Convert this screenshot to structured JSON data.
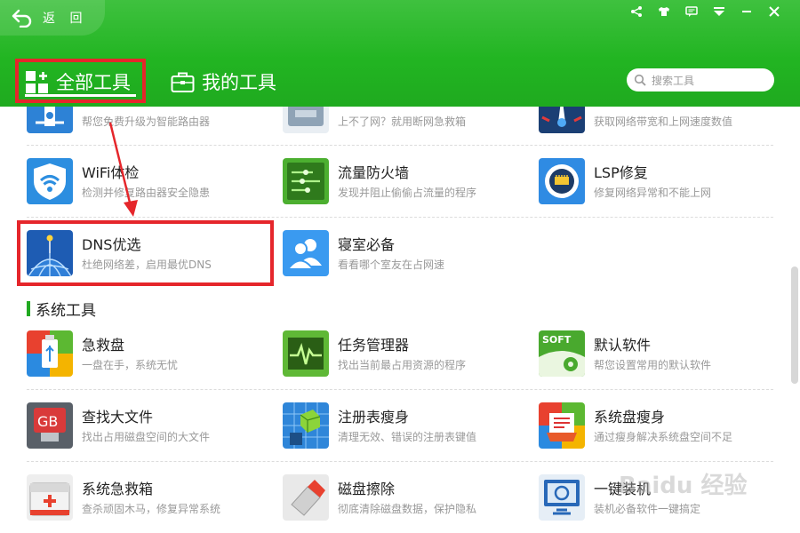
{
  "header": {
    "back_label": "返 回",
    "tabs": [
      {
        "label": "全部工具",
        "icon": "grid-plus-icon"
      },
      {
        "label": "我的工具",
        "icon": "toolbox-icon"
      }
    ],
    "search": {
      "placeholder": "搜索工具"
    },
    "window_controls": [
      "share-icon",
      "skin-icon",
      "message-icon",
      "menu-icon",
      "minimize-icon",
      "close-icon"
    ],
    "colors": {
      "brand_green": "#22b522",
      "highlight_red": "#e5262b"
    }
  },
  "network_tools": {
    "partial_row": [
      {
        "title": "",
        "desc": "帮您免费升级为智能路由器",
        "icon": "router-icon"
      },
      {
        "title": "",
        "desc": "上不了网？就用断网急救箱",
        "icon": "first-aid-box-icon"
      },
      {
        "title": "",
        "desc": "获取网络带宽和上网速度数值",
        "icon": "speedometer-icon"
      }
    ],
    "rows": [
      [
        {
          "title": "WiFi体检",
          "desc": "检测并修复路由器安全隐患",
          "icon": "wifi-shield-icon"
        },
        {
          "title": "流量防火墙",
          "desc": "发现并阻止偷偷占流量的程序",
          "icon": "traffic-firewall-icon"
        },
        {
          "title": "LSP修复",
          "desc": "修复网络异常和不能上网",
          "icon": "lsp-repair-icon"
        }
      ],
      [
        {
          "title": "DNS优选",
          "desc": "杜绝网络差，启用最优DNS",
          "icon": "dns-globe-icon"
        },
        {
          "title": "寝室必备",
          "desc": "看看哪个室友在占网速",
          "icon": "roommates-icon"
        }
      ]
    ]
  },
  "system_tools": {
    "section_title": "系统工具",
    "rows": [
      [
        {
          "title": "急救盘",
          "desc": "一盘在手，系统无忧",
          "icon": "usb-rescue-icon"
        },
        {
          "title": "任务管理器",
          "desc": "找出当前最占用资源的程序",
          "icon": "task-manager-icon"
        },
        {
          "title": "默认软件",
          "desc": "帮您设置常用的默认软件",
          "icon": "soft-default-icon",
          "badge": "SOFT"
        }
      ],
      [
        {
          "title": "查找大文件",
          "desc": "找出占用磁盘空间的大文件",
          "icon": "big-file-icon",
          "badge": "GB"
        },
        {
          "title": "注册表瘦身",
          "desc": "清理无效、错误的注册表键值",
          "icon": "registry-icon"
        },
        {
          "title": "系统盘瘦身",
          "desc": "通过瘦身解决系统盘空间不足",
          "icon": "system-disk-icon"
        }
      ],
      [
        {
          "title": "系统急救箱",
          "desc": "查杀顽固木马，修复异常系统",
          "icon": "system-rescue-box-icon"
        },
        {
          "title": "磁盘擦除",
          "desc": "彻底清除磁盘数据，保护隐私",
          "icon": "eraser-icon"
        },
        {
          "title": "一键装机",
          "desc": "装机必备软件一键搞定",
          "icon": "one-click-install-icon"
        }
      ]
    ]
  },
  "watermark": "Baidu 经验"
}
